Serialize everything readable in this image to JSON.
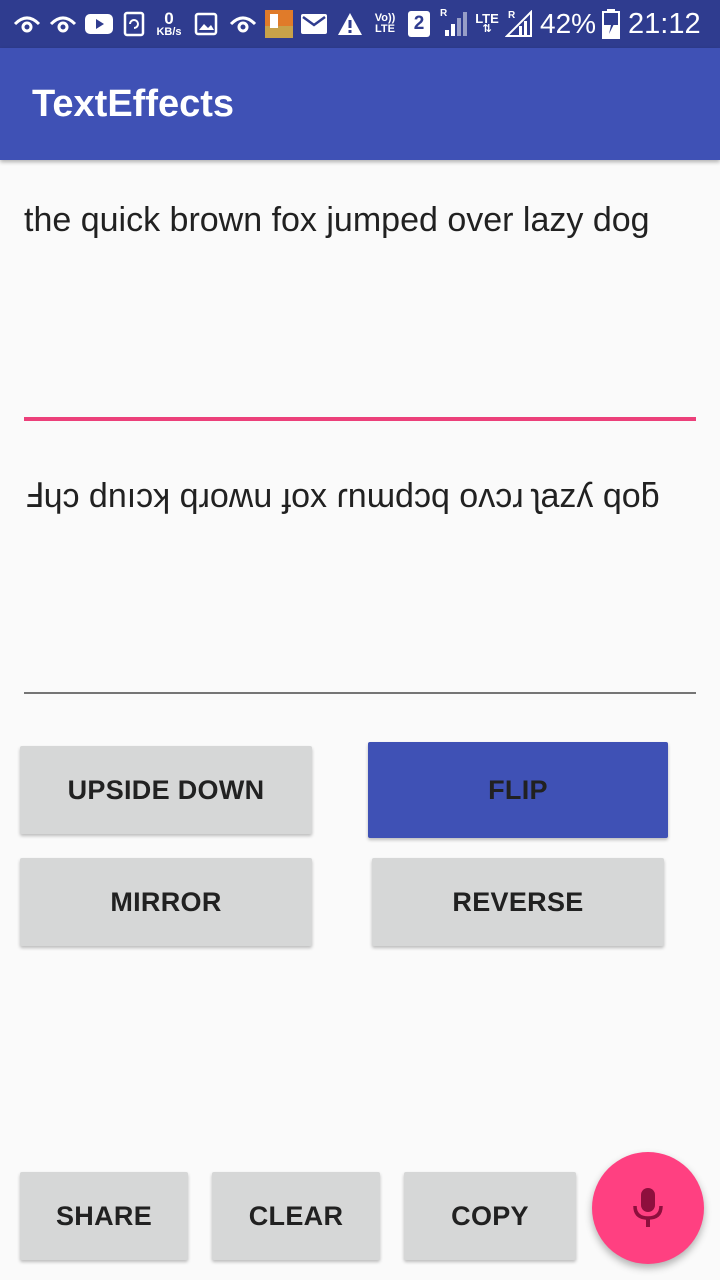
{
  "status_bar": {
    "icons": [
      "wifi-sync-icon",
      "wifi-sync-icon",
      "youtube-icon",
      "sync-icon",
      "gallery-icon",
      "wifi-sync-icon",
      "app-notification-icon",
      "mail-icon",
      "warning-icon",
      "sim-2-icon",
      "signal-icon",
      "signal-icon"
    ],
    "net_speed_value": "0",
    "net_speed_unit": "KB/s",
    "volte_line1": "Vo))",
    "volte_line2": "LTE",
    "sim_badge": "2",
    "lte_label": "LTE",
    "roaming_r1": "R",
    "roaming_r2": "R",
    "battery_percent": "42%",
    "time": "21:12"
  },
  "app_bar": {
    "title": "TextEffects"
  },
  "input": {
    "value": "the quick brown fox jumped over lazy dog"
  },
  "output": {
    "value": "Ⅎɥɔ dnıɔʞ qɹoʍu ɟox ɾnɯdɔq oʌɔɹ ʅazʎ qoƃ"
  },
  "buttons": {
    "upside_down": "UPSIDE DOWN",
    "flip": "FLIP",
    "mirror": "MIRROR",
    "reverse": "REVERSE",
    "share": "SHARE",
    "clear": "CLEAR",
    "copy": "COPY"
  },
  "colors": {
    "status_bar": "#2f3c8f",
    "primary": "#3f51b5",
    "accent": "#ff4081",
    "input_underline": "#ec407a",
    "button_bg": "#d6d7d7"
  },
  "fab": {
    "icon": "microphone-icon"
  }
}
